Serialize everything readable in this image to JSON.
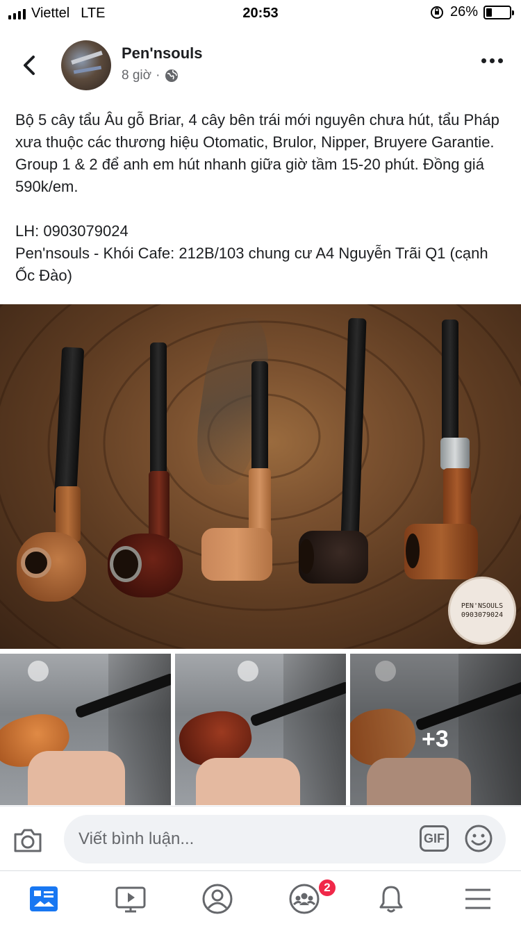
{
  "status_bar": {
    "carrier": "Viettel",
    "network": "LTE",
    "time": "20:53",
    "battery_percent": "26%",
    "battery_level": 0.26
  },
  "post": {
    "page_name": "Pen'nsouls",
    "time_ago": "8 giờ",
    "separator": "·",
    "text": "Bộ 5 cây tẩu Âu gỗ Briar, 4 cây bên trái mới nguyên chưa hút, tẩu Pháp xưa thuộc các thương hiệu Otomatic, Brulor, Nipper, Bruyere Garantie. Group 1 & 2 để anh em hút nhanh giữa giờ tầm 15-20 phút. Đồng giá 590k/em.\n\nLH: 0903079024\nPen'nsouls - Khói Cafe: 212B/103 chung cư A4 Nguyễn Trãi Q1 (cạnh Ốc Đào)",
    "watermark_line1": "PEN'NSOULS",
    "watermark_line2": "0903079024",
    "more_photos": "+3"
  },
  "comment": {
    "placeholder": "Viết bình luận...",
    "gif_label": "GIF"
  },
  "tabbar": {
    "groups_badge": "2",
    "active_color": "#1877f2"
  },
  "icons": [
    "back-icon",
    "globe-icon",
    "more-icon",
    "camera-icon",
    "gif-icon",
    "emoji-icon",
    "news-feed-icon",
    "watch-icon",
    "profile-icon",
    "groups-icon",
    "notifications-icon",
    "menu-icon"
  ]
}
